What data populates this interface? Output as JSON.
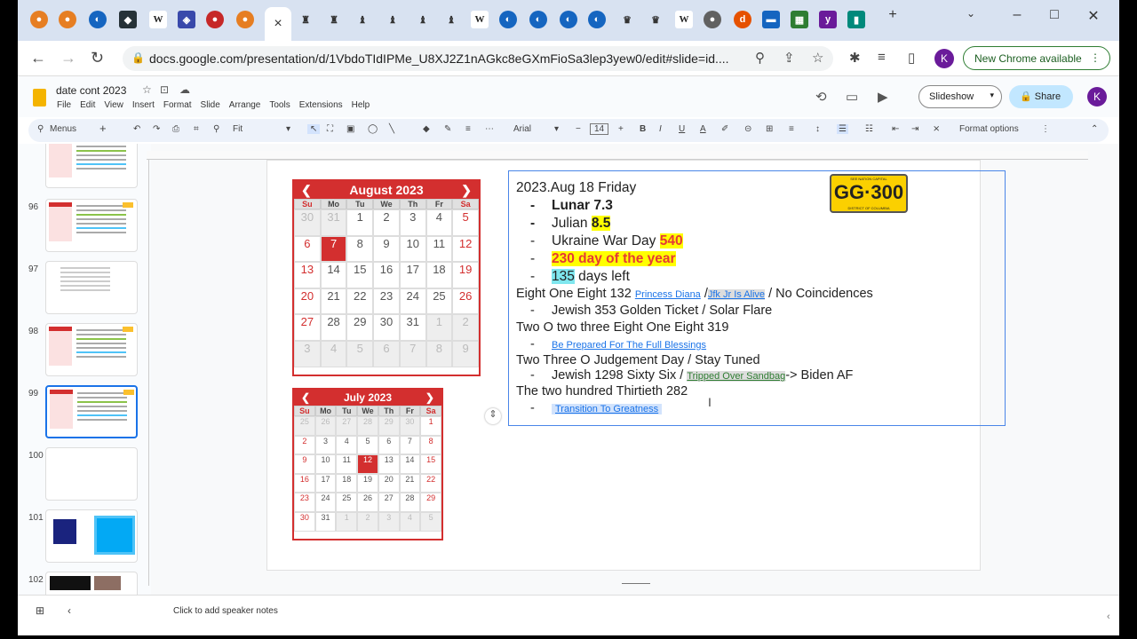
{
  "browser": {
    "tab_icons": [
      "orange-circle",
      "orange-circle",
      "blue-sphere",
      "dark-square",
      "wiki-w",
      "shield",
      "chrome",
      "orange-circle",
      "active",
      "figure",
      "figure",
      "bird",
      "bird",
      "bird",
      "wiki-w",
      "globe",
      "globe",
      "globe",
      "crown",
      "crown",
      "wiki-w",
      "eye",
      "orange-d",
      "square",
      "game",
      "yahoo",
      "book"
    ],
    "tab_close": "×",
    "new_tab": "+",
    "url": "docs.google.com/presentation/d/1VbdoTIdIPMe_U8XJ2Z1nAGkc8eGXmFioSa3lep3yew0/edit#slide=id....",
    "new_chrome": "New Chrome available",
    "profile": "K"
  },
  "docs": {
    "title": "date cont 2023",
    "menus": [
      "File",
      "Edit",
      "View",
      "Insert",
      "Format",
      "Slide",
      "Arrange",
      "Tools",
      "Extensions",
      "Help"
    ],
    "slideshow": "Slideshow",
    "share": "Share",
    "profile": "K"
  },
  "toolbar": {
    "menus": "Menus",
    "zoom": "Fit",
    "font": "Arial",
    "font_size": "14",
    "format_options": "Format options"
  },
  "filmstrip": {
    "slides": [
      {
        "num": "",
        "type": "calendar"
      },
      {
        "num": "96",
        "type": "calendar"
      },
      {
        "num": "97",
        "type": "text"
      },
      {
        "num": "98",
        "type": "calendar"
      },
      {
        "num": "99",
        "type": "calendar",
        "selected": true
      },
      {
        "num": "100",
        "type": "blank"
      },
      {
        "num": "101",
        "type": "images"
      },
      {
        "num": "102",
        "type": "images"
      }
    ]
  },
  "august": {
    "title": "August 2023",
    "prev": "❮",
    "next": "❯",
    "dow": [
      "Su",
      "Mo",
      "Tu",
      "We",
      "Th",
      "Fr",
      "Sa"
    ],
    "days": [
      "30",
      "31",
      "1",
      "2",
      "3",
      "4",
      "5",
      "6",
      "7",
      "8",
      "9",
      "10",
      "11",
      "12",
      "13",
      "14",
      "15",
      "16",
      "17",
      "18",
      "19",
      "20",
      "21",
      "22",
      "23",
      "24",
      "25",
      "26",
      "27",
      "28",
      "29",
      "30",
      "31",
      "1",
      "2",
      "3",
      "4",
      "5",
      "6",
      "7",
      "8",
      "9"
    ]
  },
  "july": {
    "title": "July 2023",
    "prev": "❮",
    "next": "❯",
    "dow": [
      "Su",
      "Mo",
      "Tu",
      "We",
      "Th",
      "Fr",
      "Sa"
    ],
    "days": [
      "25",
      "26",
      "27",
      "28",
      "29",
      "30",
      "1",
      "2",
      "3",
      "4",
      "5",
      "6",
      "7",
      "8",
      "9",
      "10",
      "11",
      "12",
      "13",
      "14",
      "15",
      "16",
      "17",
      "18",
      "19",
      "20",
      "21",
      "22",
      "23",
      "24",
      "25",
      "26",
      "27",
      "28",
      "29",
      "30",
      "31",
      "1",
      "2",
      "3",
      "4",
      "5"
    ]
  },
  "content": {
    "l1": "2023.Aug 18 Friday",
    "l2_dash": "-",
    "l2": "Lunar 7.3",
    "l3_dash": "-",
    "l3a": "Julian ",
    "l3b": "8.5",
    "l4_dash": "-",
    "l4a": "Ukraine War Day ",
    "l4b": "540",
    "l5_dash": "-",
    "l5": "230 day of the year",
    "l6_dash": "-",
    "l6a": "135",
    "l6b": " days left",
    "l7a": "Eight One Eight 132 ",
    "l7link1": "Princess Diana",
    "l7sep": " /",
    "l7link2": "Jfk Jr Is Alive",
    "l7b": " / No Coincidences",
    "l8_dash": "-",
    "l8": "Jewish 353 Golden Ticket / Solar Flare",
    "l9": "Two O two three Eight One Eight 319",
    "l10_dash": "-",
    "l10link": "Be Prepared For The Full Blessings",
    "l11": "Two Three O Judgement Day / Stay Tuned",
    "l12_dash": "-",
    "l12a": "Jewish 1298 Sixty Six / ",
    "l12link": "Tripped Over Sandbag",
    "l12b": "-> Biden AF",
    "l13": "The two hundred Thirtieth 282",
    "l14_dash": "-",
    "l14link": "Transition To Greatness"
  },
  "plate": {
    "text": "GG·300",
    "top": "SEE NATION CAPITAL",
    "bottom": "DISTRICT OF COLUMBIA"
  },
  "notes": {
    "placeholder": "Click to add speaker notes"
  }
}
